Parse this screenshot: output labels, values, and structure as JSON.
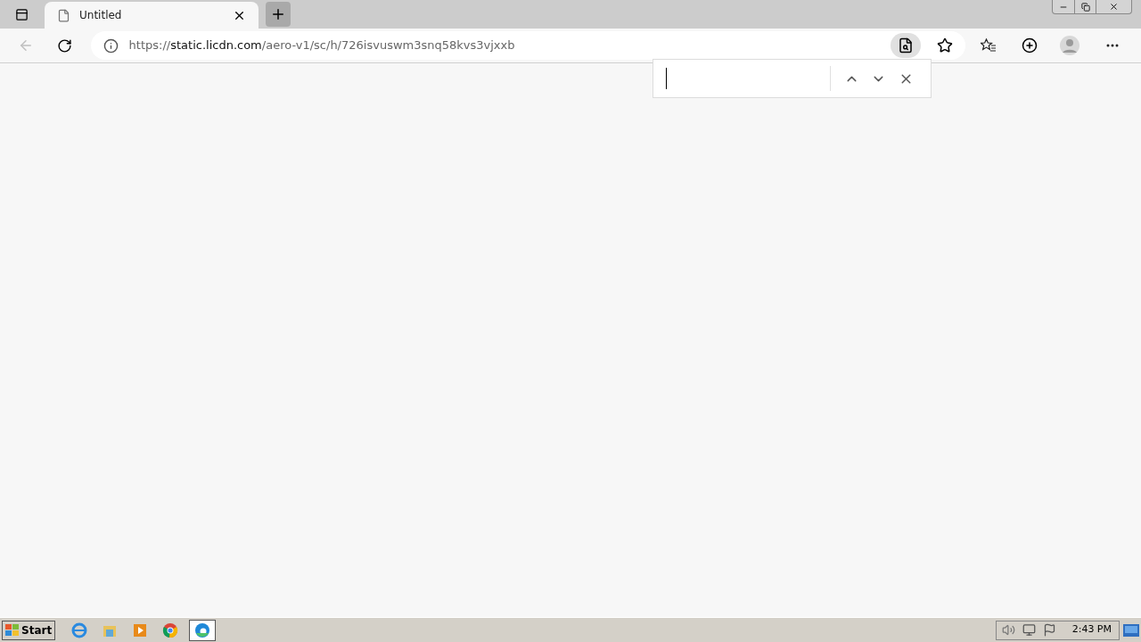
{
  "tab": {
    "title": "Untitled",
    "selected": true
  },
  "address_bar": {
    "scheme": "https://",
    "host": "static.licdn.com",
    "path": "/aero-v1/sc/h/726isvuswm3snq58kvs3vjxxb"
  },
  "find_bar": {
    "open": true
  },
  "taskbar": {
    "start": "Start",
    "apps": [
      {
        "kind": "ie",
        "selected": false
      },
      {
        "kind": "explorer",
        "selected": false
      },
      {
        "kind": "media",
        "selected": false
      },
      {
        "kind": "chrome",
        "selected": false
      },
      {
        "kind": "edge",
        "selected": true
      }
    ],
    "clock": "2:43 PM"
  }
}
